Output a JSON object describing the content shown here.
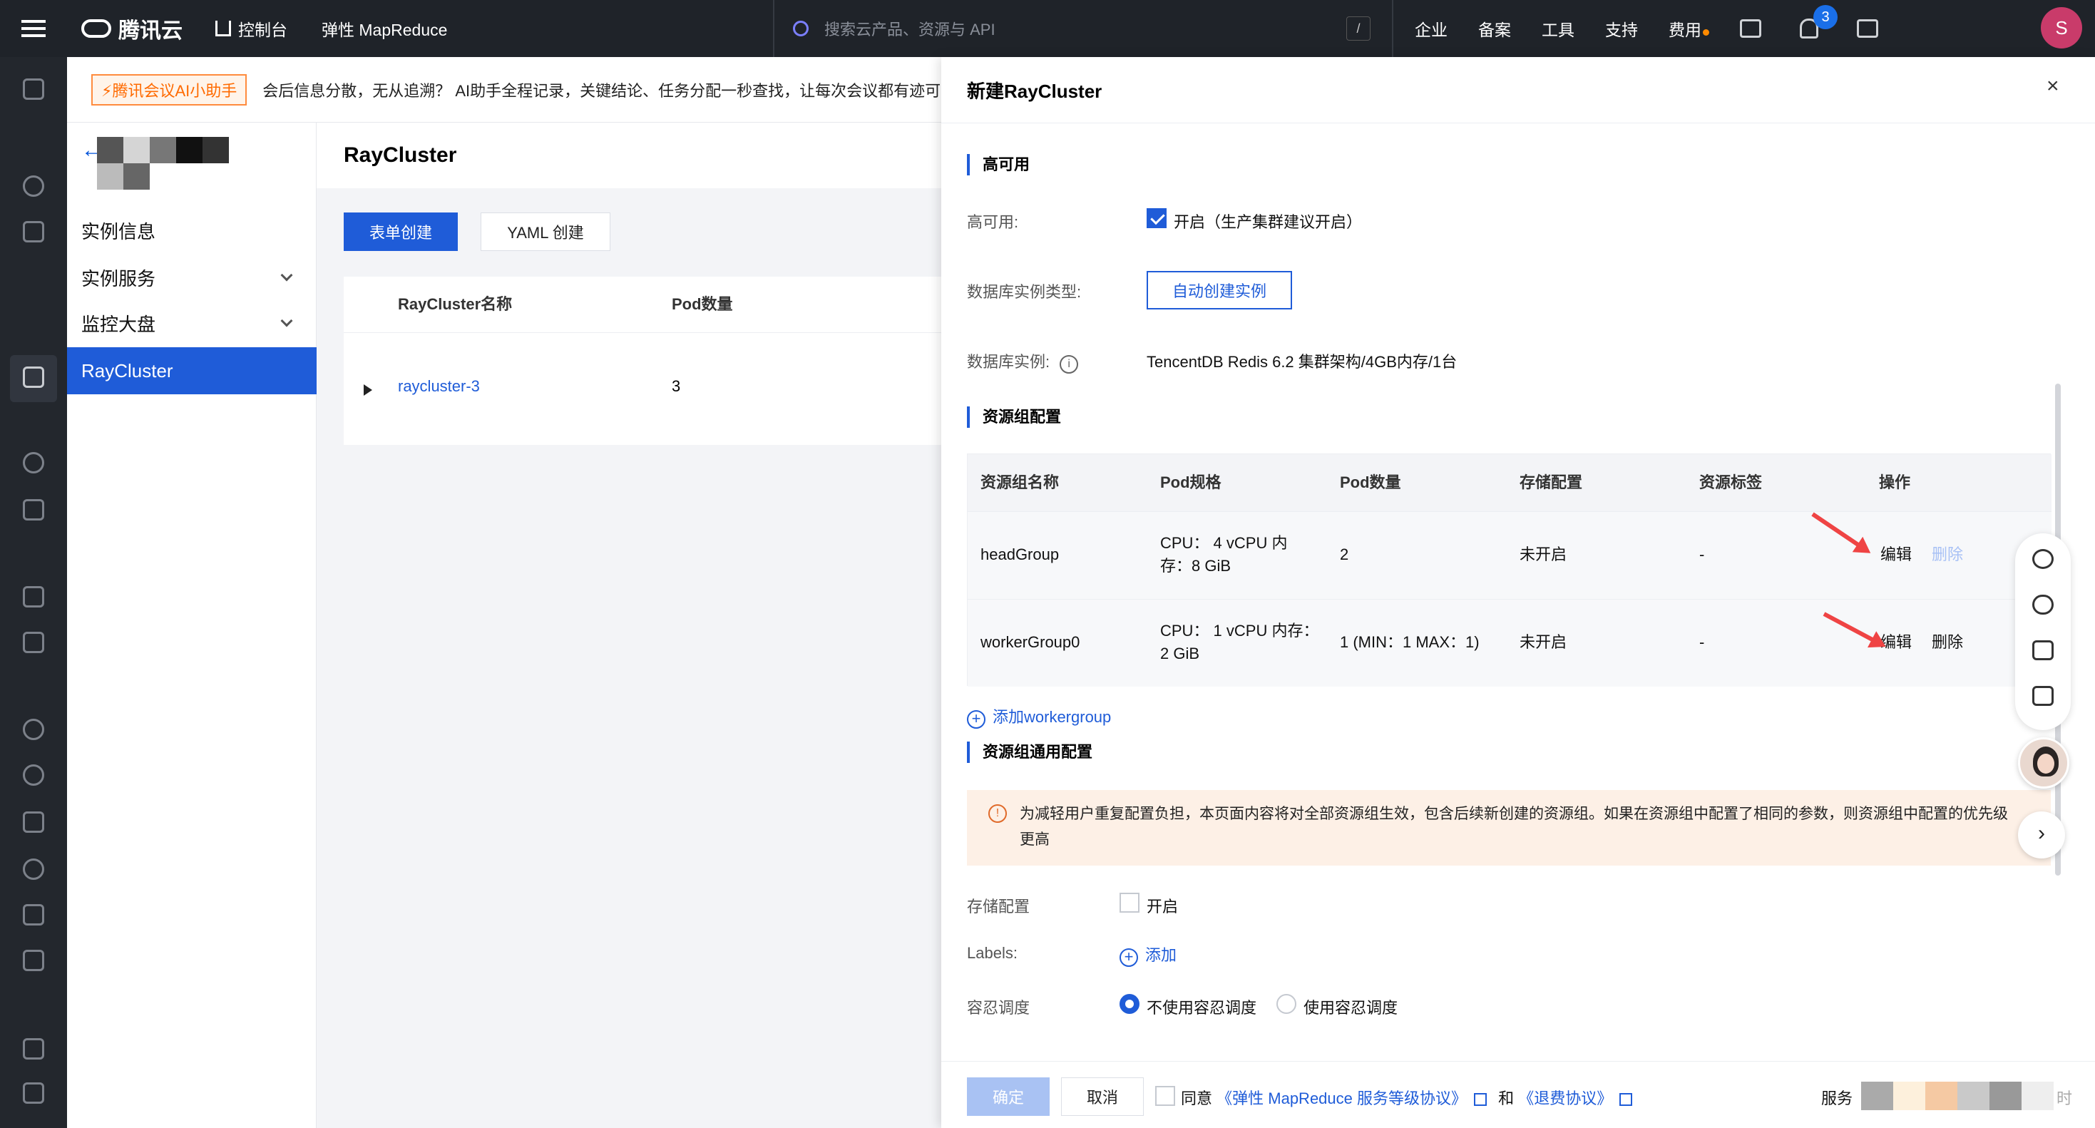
{
  "topbar": {
    "logo_text": "腾讯云",
    "console": "控制台",
    "product": "弹性 MapReduce",
    "search_placeholder": "搜索云产品、资源与 API",
    "search_shortcut": "/",
    "links": [
      "企业",
      "备案",
      "工具",
      "支持",
      "费用"
    ],
    "notifications": "3",
    "avatar": "S"
  },
  "notice": {
    "tag": "⚡腾讯会议AI小助手",
    "text": "会后信息分散，无从追溯？ AI助手全程记录，关键结论、任务分配一秒查找，让每次会议都有迹可循"
  },
  "sidebar": {
    "back": "←",
    "items": [
      {
        "label": "实例信息"
      },
      {
        "label": "实例服务"
      },
      {
        "label": "监控大盘"
      },
      {
        "label": "RayCluster"
      }
    ]
  },
  "main": {
    "title": "RayCluster",
    "btn_form": "表单创建",
    "btn_yaml": "YAML 创建",
    "columns": [
      "RayCluster名称",
      "Pod数量"
    ],
    "rows": [
      {
        "name": "raycluster-3",
        "pods": "3"
      }
    ]
  },
  "drawer": {
    "title": "新建RayCluster",
    "close": "×",
    "ha_section": "高可用",
    "ha_label": "高可用:",
    "ha_value": "开启（生产集群建议开启）",
    "db_type_label": "数据库实例类型:",
    "db_type_btn": "自动创建实例",
    "db_inst_label": "数据库实例:",
    "db_inst_value": "TencentDB Redis 6.2 集群架构/4GB内存/1台",
    "rg_section": "资源组配置",
    "rg_columns": [
      "资源组名称",
      "Pod规格",
      "Pod数量",
      "存储配置",
      "资源标签",
      "操作"
    ],
    "rg_rows": [
      {
        "name": "headGroup",
        "spec_l1": "CPU： 4 vCPU 内",
        "spec_l2": "存：8 GiB",
        "pods": "2",
        "storage": "未开启",
        "labels": "-",
        "edit": "编辑",
        "del": "删除"
      },
      {
        "name": "workerGroup0",
        "spec_l1": "CPU： 1 vCPU 内存：",
        "spec_l2": "2 GiB",
        "pods": "1 (MIN：1 MAX：1)",
        "storage": "未开启",
        "labels": "-",
        "edit": "编辑",
        "del": "删除"
      }
    ],
    "add_wg": "添加workergroup",
    "common_section": "资源组通用配置",
    "warn_icon": "!",
    "warn_text": "为减轻用户重复配置负担，本页面内容将对全部资源组生效，包含后续新创建的资源组。如果在资源组中配置了相同的参数，则资源组中配置的优先级更高",
    "storage_label": "存储配置",
    "storage_opt": "开启",
    "labels_label": "Labels:",
    "labels_add": "添加",
    "toleration_label": "容忍调度",
    "toleration_opt1": "不使用容忍调度",
    "toleration_opt2": "使用容忍调度",
    "footer": {
      "ok": "确定",
      "cancel": "取消",
      "agree": "同意",
      "sla": "《弹性 MapReduce 服务等级协议》",
      "and": "和",
      "refund": "《退费协议》",
      "service": "服务",
      "service_tail": "时"
    }
  },
  "float": {
    "next": "›"
  },
  "colors": {
    "primary": "#1f5cd8",
    "topbar": "#1f2329",
    "warn_bg": "#fdf0e6",
    "arrow": "#ef4444"
  }
}
